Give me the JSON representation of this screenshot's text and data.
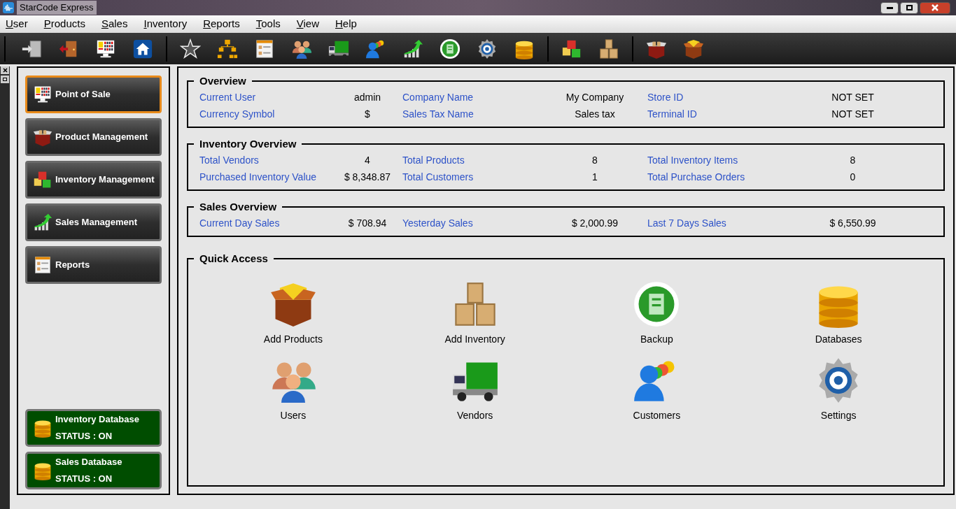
{
  "window": {
    "title": "StarCode Express"
  },
  "menu": [
    {
      "label": "User"
    },
    {
      "label": "Products"
    },
    {
      "label": "Sales"
    },
    {
      "label": "Inventory"
    },
    {
      "label": "Reports"
    },
    {
      "label": "Tools"
    },
    {
      "label": "View"
    },
    {
      "label": "Help"
    }
  ],
  "toolbar": [
    {
      "kind": "login"
    },
    {
      "kind": "logout"
    },
    {
      "kind": "pos"
    },
    {
      "kind": "home"
    },
    {
      "kind": "separator"
    },
    {
      "kind": "star"
    },
    {
      "kind": "hierarchy"
    },
    {
      "kind": "report"
    },
    {
      "kind": "users"
    },
    {
      "kind": "truck"
    },
    {
      "kind": "customers"
    },
    {
      "kind": "chart"
    },
    {
      "kind": "backup"
    },
    {
      "kind": "gear"
    },
    {
      "kind": "database"
    },
    {
      "kind": "separator"
    },
    {
      "kind": "cubes"
    },
    {
      "kind": "boxes"
    },
    {
      "kind": "separator"
    },
    {
      "kind": "box"
    },
    {
      "kind": "box-gold"
    }
  ],
  "sidebar": {
    "items": [
      {
        "label": "Point of Sale",
        "selected": true
      },
      {
        "label": "Product Management",
        "selected": false
      },
      {
        "label": "Inventory Management",
        "selected": false
      },
      {
        "label": "Sales Management",
        "selected": false
      },
      {
        "label": "Reports",
        "selected": false
      }
    ],
    "databases": [
      {
        "name": "Inventory Database",
        "status": "STATUS : ON",
        "color": "#004d00"
      },
      {
        "name": "Sales Database",
        "status": "STATUS : ON",
        "color": "#004d00"
      }
    ]
  },
  "overview": {
    "title": "Overview",
    "rows": [
      [
        {
          "label": "Current User",
          "value": "admin"
        },
        {
          "label": "Company Name",
          "value": "My Company"
        },
        {
          "label": "Store ID",
          "value": "NOT SET"
        }
      ],
      [
        {
          "label": "Currency Symbol",
          "value": "$"
        },
        {
          "label": "Sales Tax Name",
          "value": "Sales tax"
        },
        {
          "label": "Terminal ID",
          "value": "NOT SET"
        }
      ]
    ]
  },
  "inventory_overview": {
    "title": "Inventory Overview",
    "rows": [
      [
        {
          "label": "Total Vendors",
          "value": "4"
        },
        {
          "label": "Total Products",
          "value": "8"
        },
        {
          "label": "Total Inventory Items",
          "value": "8"
        }
      ],
      [
        {
          "label": "Purchased Inventory Value",
          "value": "$ 8,348.87"
        },
        {
          "label": "Total Customers",
          "value": "1"
        },
        {
          "label": "Total Purchase Orders",
          "value": "0"
        }
      ]
    ]
  },
  "sales_overview": {
    "title": "Sales Overview",
    "rows": [
      [
        {
          "label": "Current Day Sales",
          "value": "$ 708.94"
        },
        {
          "label": "Yesterday Sales",
          "value": "$ 2,000.99"
        },
        {
          "label": "Last 7 Days Sales",
          "value": "$ 6,550.99"
        }
      ]
    ]
  },
  "quick_access": {
    "title": "Quick Access",
    "items": [
      {
        "label": "Add Products"
      },
      {
        "label": "Add Inventory"
      },
      {
        "label": "Backup"
      },
      {
        "label": "Databases"
      },
      {
        "label": "Users"
      },
      {
        "label": "Vendors"
      },
      {
        "label": "Customers"
      },
      {
        "label": "Settings"
      }
    ]
  }
}
